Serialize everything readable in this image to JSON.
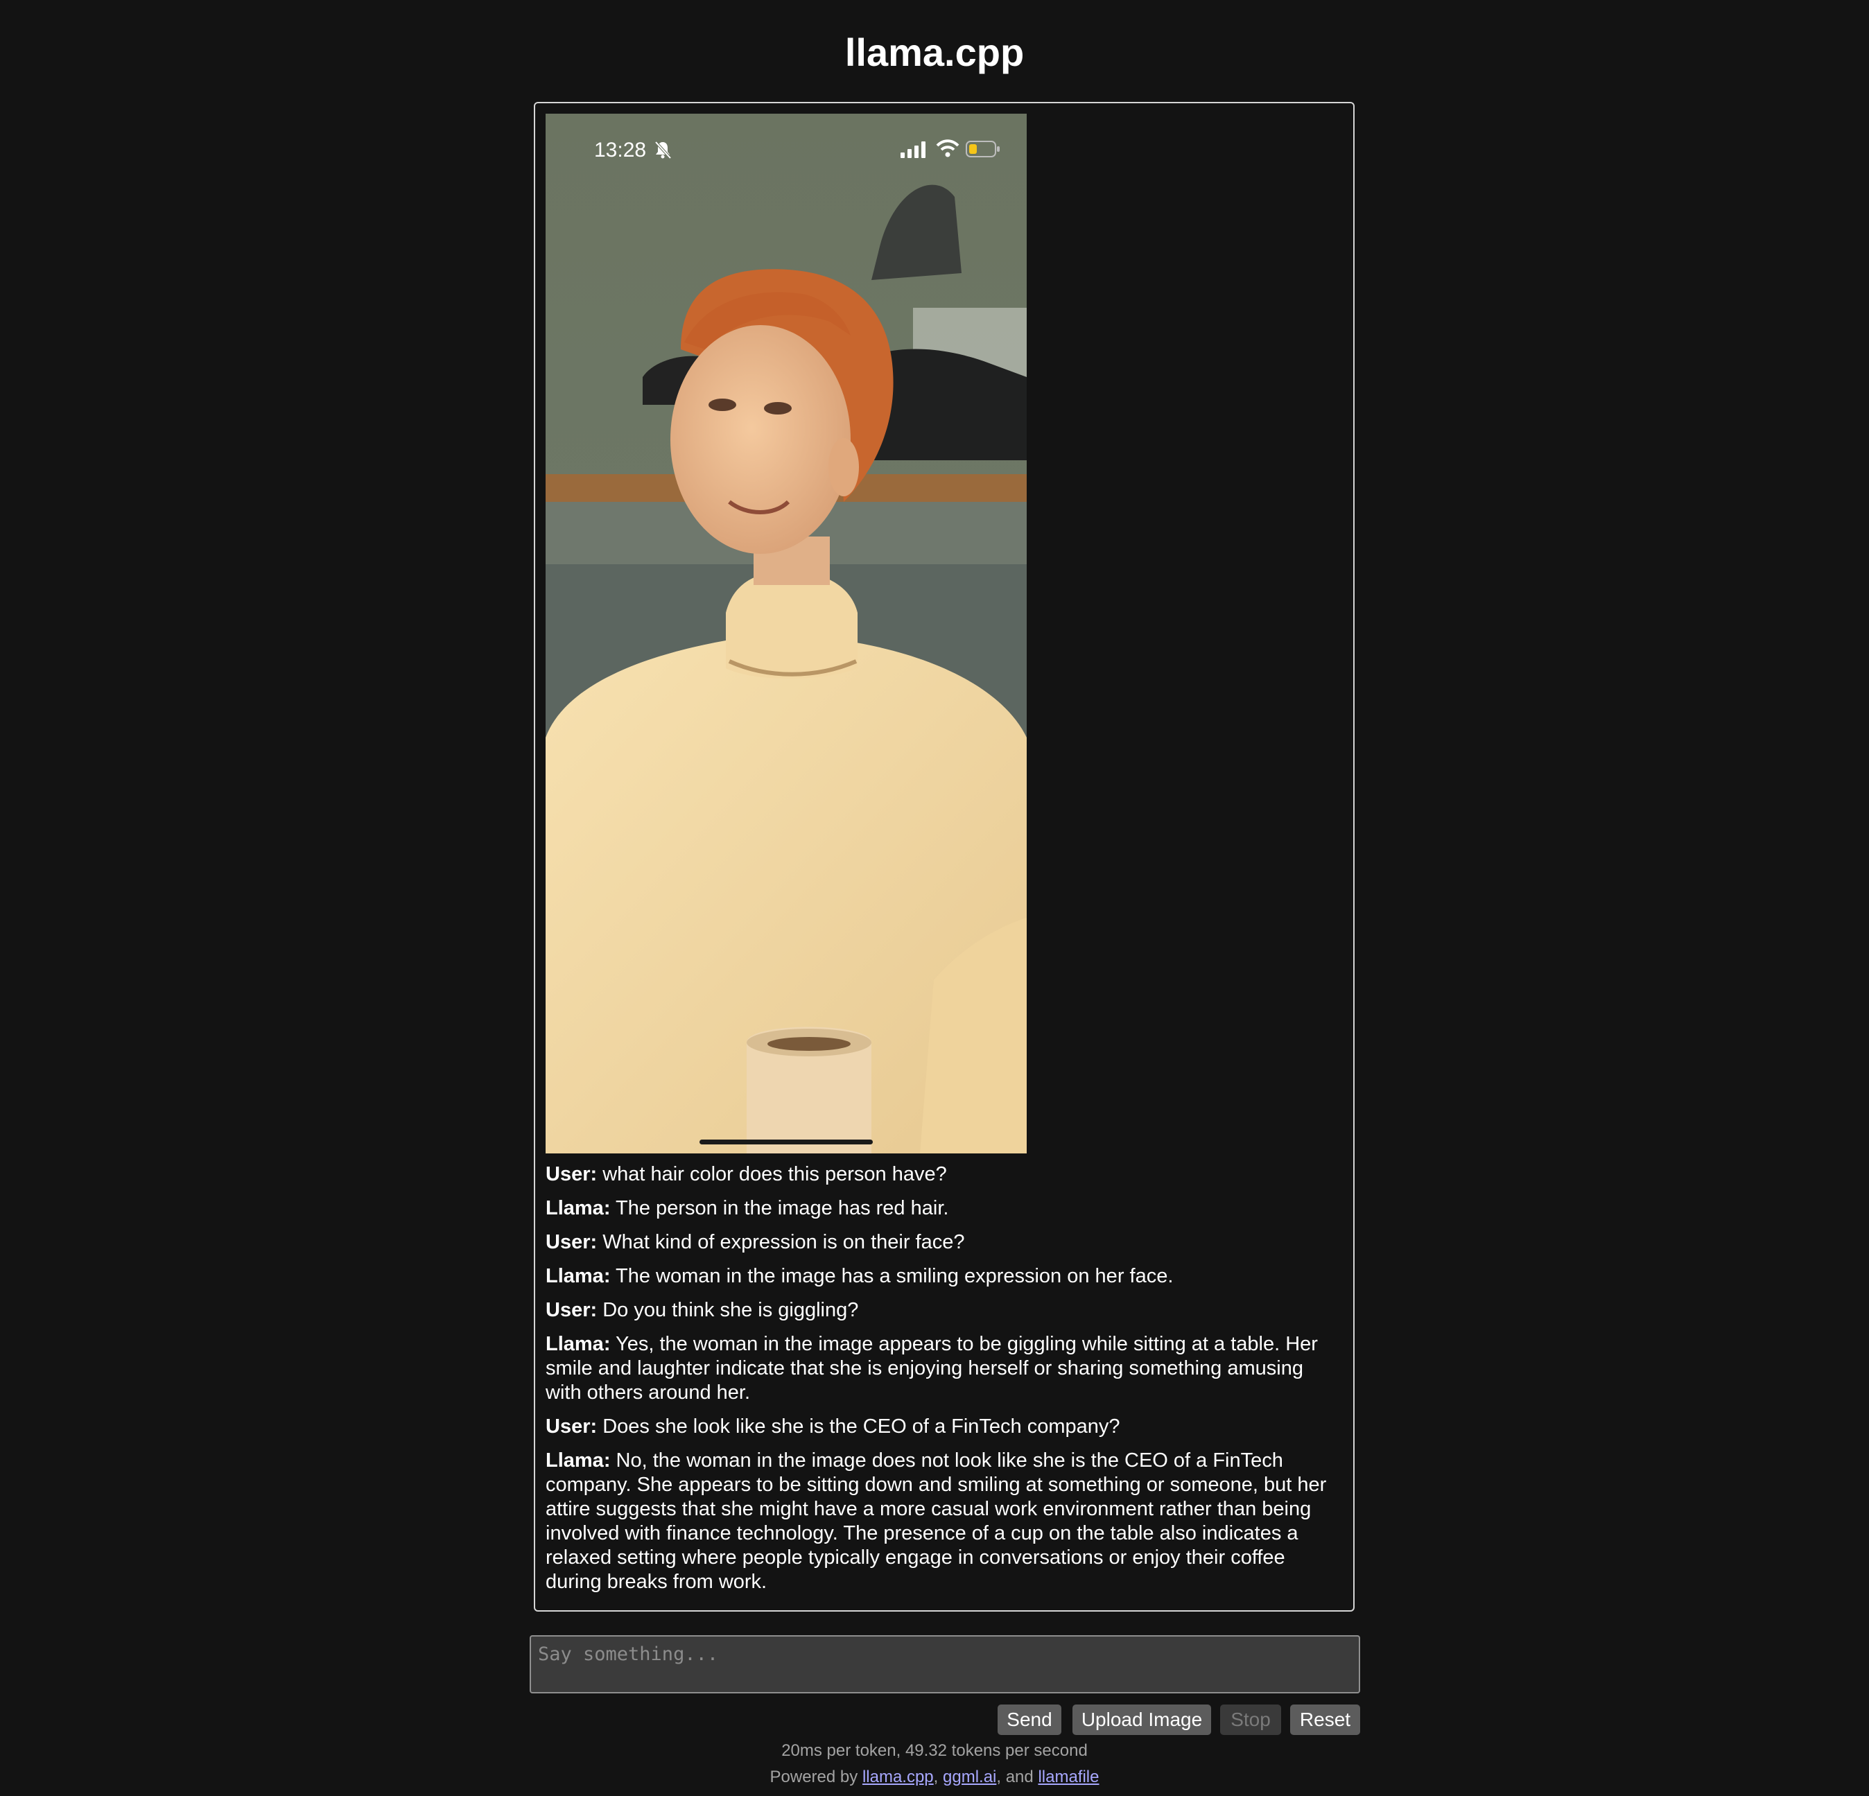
{
  "app": {
    "title": "llama.cpp"
  },
  "photo": {
    "status_time": "13:28",
    "icons": [
      "bell-slash-icon",
      "signal-icon",
      "wifi-icon",
      "battery-low-icon"
    ],
    "battery_color": "#f5c518"
  },
  "messages": [
    {
      "speaker": "User:",
      "text": "what hair color does this person have?"
    },
    {
      "speaker": "Llama:",
      "text": "The person in the image has red hair."
    },
    {
      "speaker": "User:",
      "text": "What kind of expression is on their face?"
    },
    {
      "speaker": "Llama:",
      "text": "The woman in the image has a smiling expression on her face."
    },
    {
      "speaker": "User:",
      "text": "Do you think she is giggling?"
    },
    {
      "speaker": "Llama:",
      "text": "Yes, the woman in the image appears to be giggling while sitting at a table. Her smile and laughter indicate that she is enjoying herself or sharing something amusing with others around her."
    },
    {
      "speaker": "User:",
      "text": "Does she look like she is the CEO of a FinTech company?"
    },
    {
      "speaker": "Llama:",
      "text": "No, the woman in the image does not look like she is the CEO of a FinTech company. She appears to be sitting down and smiling at something or someone, but her attire suggests that she might have a more casual work environment rather than being involved with finance technology. The presence of a cup on the table also indicates a relaxed setting where people typically engage in conversations or enjoy their coffee during breaks from work."
    }
  ],
  "input": {
    "placeholder": "Say something...",
    "value": ""
  },
  "buttons": {
    "send": "Send",
    "upload": "Upload Image",
    "stop": "Stop",
    "reset": "Reset"
  },
  "stats": "20ms per token, 49.32 tokens per second",
  "footer": {
    "prefix": "Powered by",
    "link1": "llama.cpp",
    "sep1": ",",
    "link2": "ggml.ai",
    "sep2": ", and",
    "link3": "llamafile"
  },
  "colors": {
    "background": "#131313",
    "border": "#d6d6d6",
    "button": "#5c5c5c",
    "link": "#a8a8ff"
  }
}
